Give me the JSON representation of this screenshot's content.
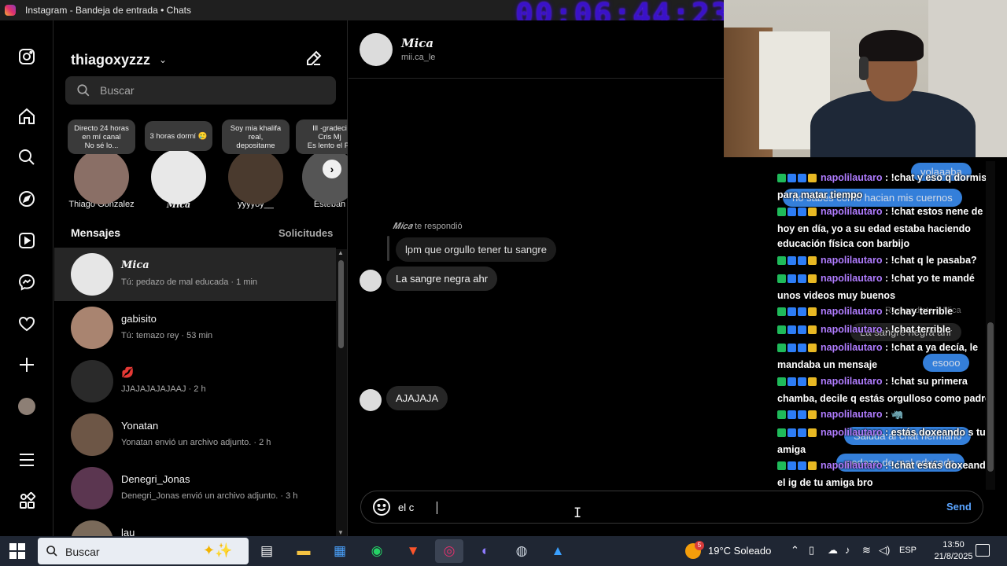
{
  "window": {
    "title": "Instagram - Bandeja de entrada • Chats",
    "stream_timer": "00:06:44:23"
  },
  "sidebar": {
    "icons": [
      "instagram-logo-icon",
      "home-icon",
      "search-icon",
      "explore-icon",
      "reels-icon",
      "messenger-icon",
      "heart-icon",
      "plus-icon",
      "profile-avatar-icon",
      "menu-icon",
      "apps-icon"
    ]
  },
  "inbox": {
    "username": "thiagoxyzzz",
    "search_placeholder": "Buscar",
    "notes": [
      {
        "text": "Directo 24 horas\nen mí canal\nNo sé lo...",
        "name": "Thiago Gonzalez",
        "color": "#8a6f66"
      },
      {
        "text": "3 horas dormí 🥲",
        "name": "𝑴𝒊𝒄𝒂",
        "color": "#e8e8e8"
      },
      {
        "text": "Soy mia khalifa\nreal,\ndepositame",
        "name": "yyyyoy__",
        "color": "#4a3a2e"
      },
      {
        "text": "Ill ·gradeci\nCris Mj\nEs lento el Pr",
        "name": "Esteban",
        "color": "#555"
      }
    ],
    "messages_header": "Mensajes",
    "requests_label": "Solicitudes",
    "conversations": [
      {
        "name": "𝑴𝒊𝒄𝒂",
        "preview": "Tú: pedazo de mal educada · 1 min",
        "color": "#e6e6e6",
        "active": true
      },
      {
        "name": "gabisito",
        "preview": "Tú: temazo rey · 53 min",
        "color": "#a98470",
        "active": false
      },
      {
        "name": "💋",
        "preview": "JJAJAJAJAJAAJ · 2 h",
        "color": "#2a2a2a",
        "active": false
      },
      {
        "name": "Yonatan",
        "preview": "Yonatan envió un archivo adjunto. · 2 h",
        "color": "#6d5646",
        "active": false
      },
      {
        "name": "Denegri_Jonas",
        "preview": "Denegri_Jonas envió un archivo adjunto. · 3 h",
        "color": "#5b3650",
        "active": false
      },
      {
        "name": "lau",
        "preview": "",
        "color": "#7a6a5a",
        "active": false
      }
    ]
  },
  "chat": {
    "name": "𝑴𝒊𝒄𝒂",
    "handle": "mii.ca_le",
    "reply_label_name": "𝑴𝒊𝒄𝒂",
    "reply_label_suffix": " te respondió",
    "quoted_message": "lpm que orgullo tener tu sangre",
    "messages": [
      "La sangre negra ahr",
      "AJAJAJA"
    ],
    "composer_text": "el c",
    "send_label": "Send"
  },
  "stream_chat": {
    "ghost_bubbles": [
      "volaaaba",
      "no sabes como hacian mis cuernos",
      "Respondiste a Mica",
      "La sangre negra ahr",
      "esooo",
      "Saluda al chat hermano",
      "pedazo de mal educada"
    ],
    "lines": [
      {
        "user": "napolilautaro",
        "text": "!chat y eso q dormiste para matar tiempo"
      },
      {
        "user": "napolilautaro",
        "text": "!chat estos nene de hoy en día, yo a su edad estaba haciendo educación física con barbijo"
      },
      {
        "user": "napolilautaro",
        "text": "!chat q le pasaba?"
      },
      {
        "user": "napolilautaro",
        "text": "!chat yo te mandé unos videos muy buenos"
      },
      {
        "user": "napolilautaro",
        "text": "!chay terrible"
      },
      {
        "user": "napolilautaro",
        "text": "!chat terrible"
      },
      {
        "user": "napolilautaro",
        "text": "!chat a ya decía, le mandaba un mensaje"
      },
      {
        "user": "napolilautaro",
        "text": "!chat su primera chamba, decile q estás orgulloso como padre"
      },
      {
        "user": "napolilautaro",
        "text": "🦏"
      },
      {
        "user": "napolilautaro",
        "text": "estás doxeando s tu amiga"
      },
      {
        "user": "napolilautaro",
        "text": "!chat estás doxeando el ig de tu amiga bro"
      }
    ]
  },
  "taskbar": {
    "search_placeholder": "Buscar",
    "weather": "19°C Soleado",
    "weather_badge": "5",
    "lang": "ESP",
    "time": "13:50",
    "date": "21/8/2025"
  }
}
